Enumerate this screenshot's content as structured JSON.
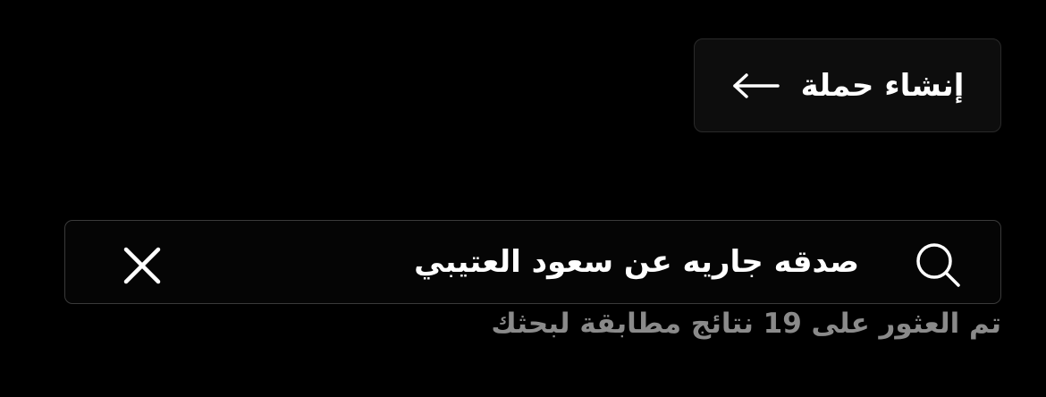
{
  "create_campaign": {
    "label": "إنشاء حملة",
    "icon": "arrow-left-icon"
  },
  "search": {
    "value": "صدقه جاريه عن سعود العتيبي",
    "icon": "search-icon",
    "clear_icon": "close-icon"
  },
  "results": {
    "summary": "تم العثور على 19 نتائج مطابقة لبحثك"
  },
  "colors": {
    "background": "#000000",
    "button_background": "#0d0d0d",
    "border": "#2a2a2a",
    "text": "#ffffff",
    "muted_text": "#8a8a8a"
  }
}
